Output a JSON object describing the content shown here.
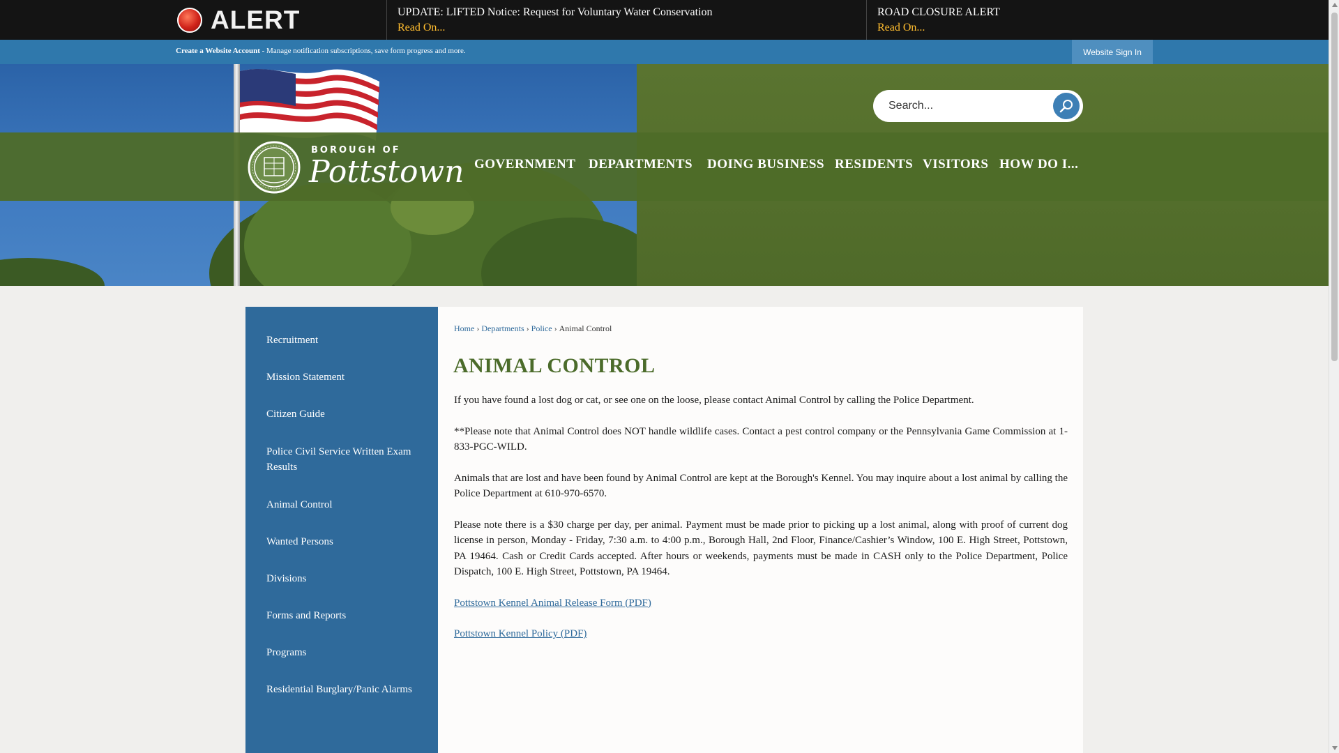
{
  "alert": {
    "label": "ALERT",
    "items": [
      {
        "title": "UPDATE: LIFTED Notice: Request for Voluntary Water Conservation",
        "more": "Read On..."
      },
      {
        "title": "ROAD CLOSURE ALERT",
        "more": "Read On..."
      }
    ]
  },
  "account": {
    "create_link": "Create a Website Account",
    "description": " - Manage notification subscriptions, save form progress and more.",
    "signin_label": "Website Sign In"
  },
  "search": {
    "placeholder": "Search..."
  },
  "logo": {
    "small": "BOROUGH OF",
    "big": "Pottstown"
  },
  "nav": {
    "items": [
      "GOVERNMENT",
      "DEPARTMENTS",
      "DOING BUSINESS",
      "RESIDENTS",
      "VISITORS",
      "HOW DO I..."
    ]
  },
  "sidebar": {
    "items": [
      "Recruitment",
      "Mission Statement",
      "Citizen Guide",
      "Police Civil Service Written Exam Results",
      "Animal Control",
      "Wanted Persons",
      "Divisions",
      "Forms and Reports",
      "Programs",
      "Residential Burglary/Panic Alarms"
    ]
  },
  "breadcrumb": {
    "home": "Home",
    "departments": "Departments",
    "police": "Police",
    "current": "Animal Control",
    "separator": "›"
  },
  "page": {
    "title": "ANIMAL CONTROL",
    "paragraphs": [
      "If you have found a lost dog or cat, or see one on the loose, please contact Animal Control by calling the Police Department.",
      "**Please note that Animal Control does NOT handle wildlife cases. Contact a pest control company or the Pennsylvania Game Commission at 1-833-PGC-WILD.",
      "Animals that are lost and have been found by Animal Control are kept at the Borough's Kennel.  You may inquire about a lost animal by calling the Police Department at 610-970-6570.",
      "Please note there is a $30 charge per day, per animal. Payment must be made prior to picking up a lost animal, along with proof of current dog license in person, Monday - Friday, 7:30 a.m. to 4:00 p.m., Borough Hall, 2nd Floor, Finance/Cashier’s Window, 100 E. High Street, Pottstown, PA 19464. Cash or Credit Cards accepted. After hours or weekends, payments must be made in CASH only to the Police Department, Police Dispatch, 100 E. High Street, Pottstown, PA 19464."
    ],
    "links": [
      "Pottstown Kennel Animal Release Form (PDF)",
      "Pottstown Kennel Policy (PDF)"
    ]
  },
  "colors": {
    "accent_green": "#4b6b2a",
    "nav_blue": "#2f6a9b",
    "alert_link": "#ffbd2f"
  }
}
